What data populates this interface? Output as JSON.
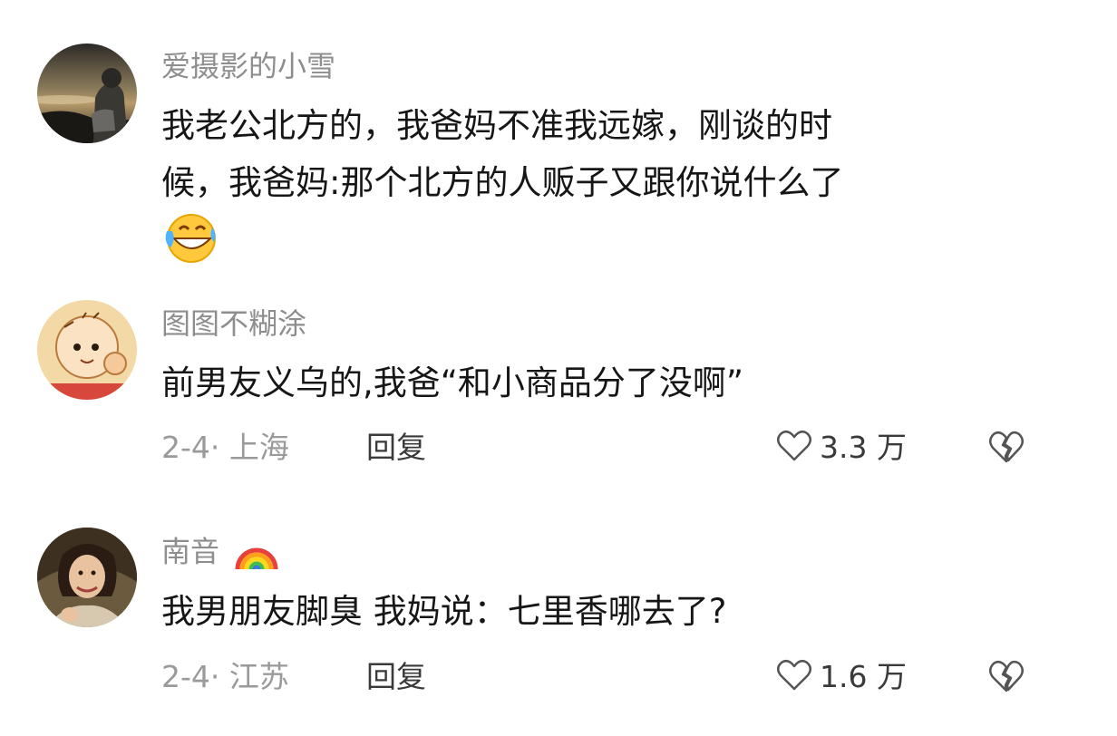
{
  "comments": [
    {
      "username": "爱摄影的小雪",
      "text_line1": "我老公北方的，我爸妈不准我远嫁，刚谈的时",
      "text_line2": "候，我爸妈:那个北方的人贩子又跟你说什么了",
      "emoji": "laughing-crying-emoji"
    },
    {
      "username": "图图不糊涂",
      "text": "前男友义乌的,我爸“和小商品分了没啊”",
      "date": "2-4· 上海",
      "reply_label": "回复",
      "likes": "3.3 万"
    },
    {
      "username": "南音",
      "username_emoji": "rainbow-emoji",
      "text": "我男朋友脚臭 我妈说：七里香哪去了?",
      "date": "2-4· 江苏",
      "reply_label": "回复",
      "likes": "1.6 万"
    }
  ],
  "colors": {
    "username": "#8e8e8e",
    "text": "#161616",
    "meta": "#9a9a9a",
    "icon": "#555555"
  }
}
